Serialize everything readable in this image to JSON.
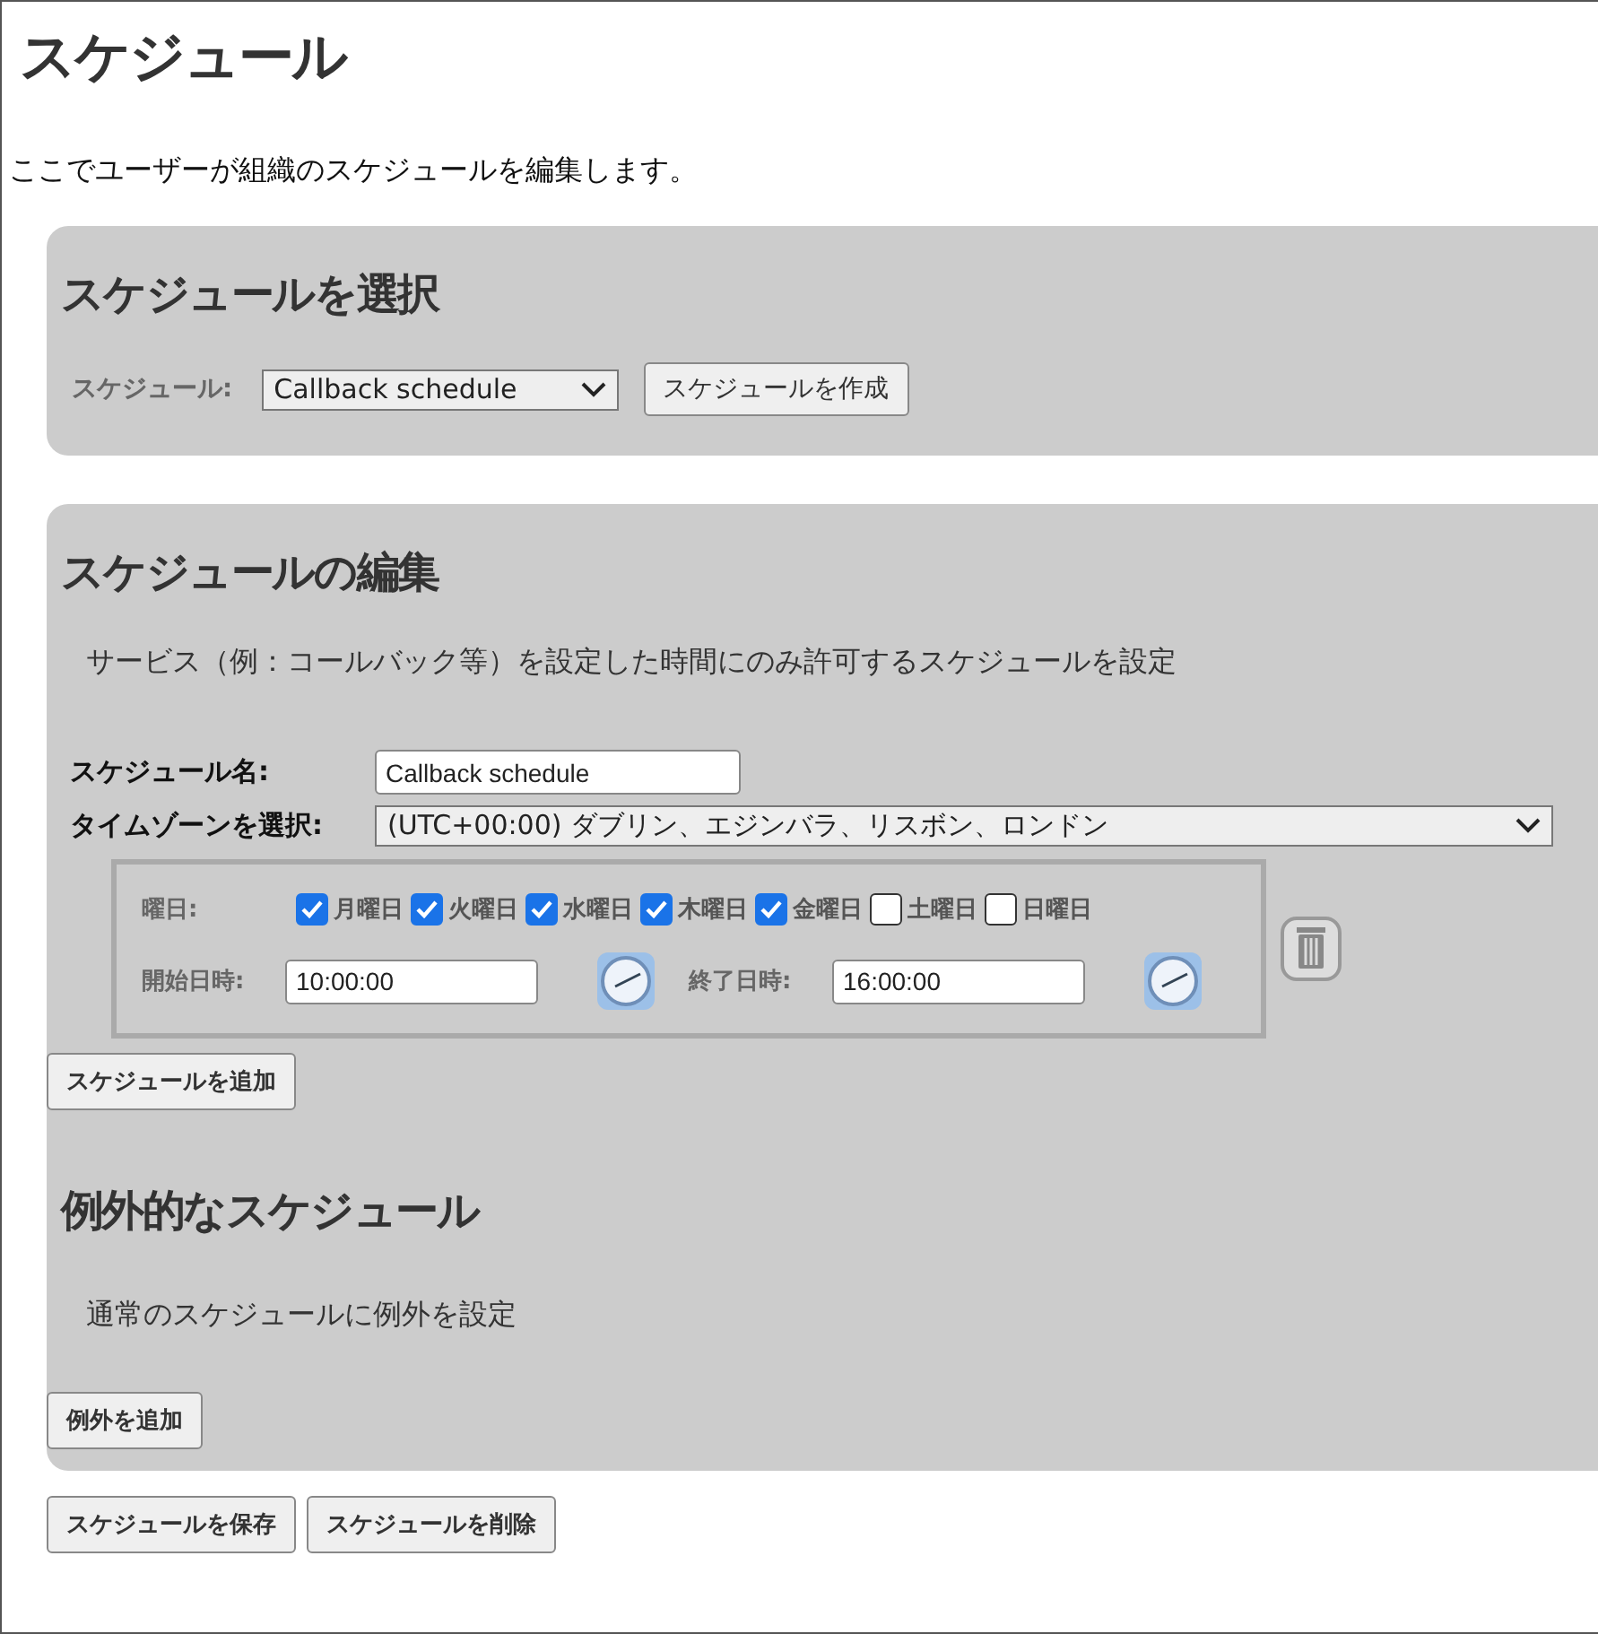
{
  "title": "スケジュール",
  "description": "ここでユーザーが組織のスケジュールを編集します。",
  "select_panel": {
    "heading": "スケジュールを選択",
    "schedule_label": "スケジュール:",
    "schedule_value": "Callback schedule",
    "create_button": "スケジュールを作成"
  },
  "edit_panel": {
    "heading": "スケジュールの編集",
    "description": "サービス（例：コールバック等）を設定した時間にのみ許可するスケジュールを設定",
    "name_label": "スケジュール名:",
    "name_value": "Callback schedule",
    "timezone_label": "タイムゾーンを選択:",
    "timezone_value": "(UTC+00:00) ダブリン、エジンバラ、リスボン、ロンドン",
    "rule": {
      "days_label": "曜日:",
      "days": [
        {
          "label": "月曜日",
          "checked": true
        },
        {
          "label": "火曜日",
          "checked": true
        },
        {
          "label": "水曜日",
          "checked": true
        },
        {
          "label": "木曜日",
          "checked": true
        },
        {
          "label": "金曜日",
          "checked": true
        },
        {
          "label": "土曜日",
          "checked": false
        },
        {
          "label": "日曜日",
          "checked": false
        }
      ],
      "start_label": "開始日時:",
      "start_value": "10:00:00",
      "end_label": "終了日時:",
      "end_value": "16:00:00"
    },
    "add_button": "スケジュールを追加"
  },
  "exceptions": {
    "heading": "例外的なスケジュール",
    "description": "通常のスケジュールに例外を設定",
    "add_button": "例外を追加"
  },
  "buttons": [
    "スケジュールを保存",
    "スケジュールを削除"
  ]
}
